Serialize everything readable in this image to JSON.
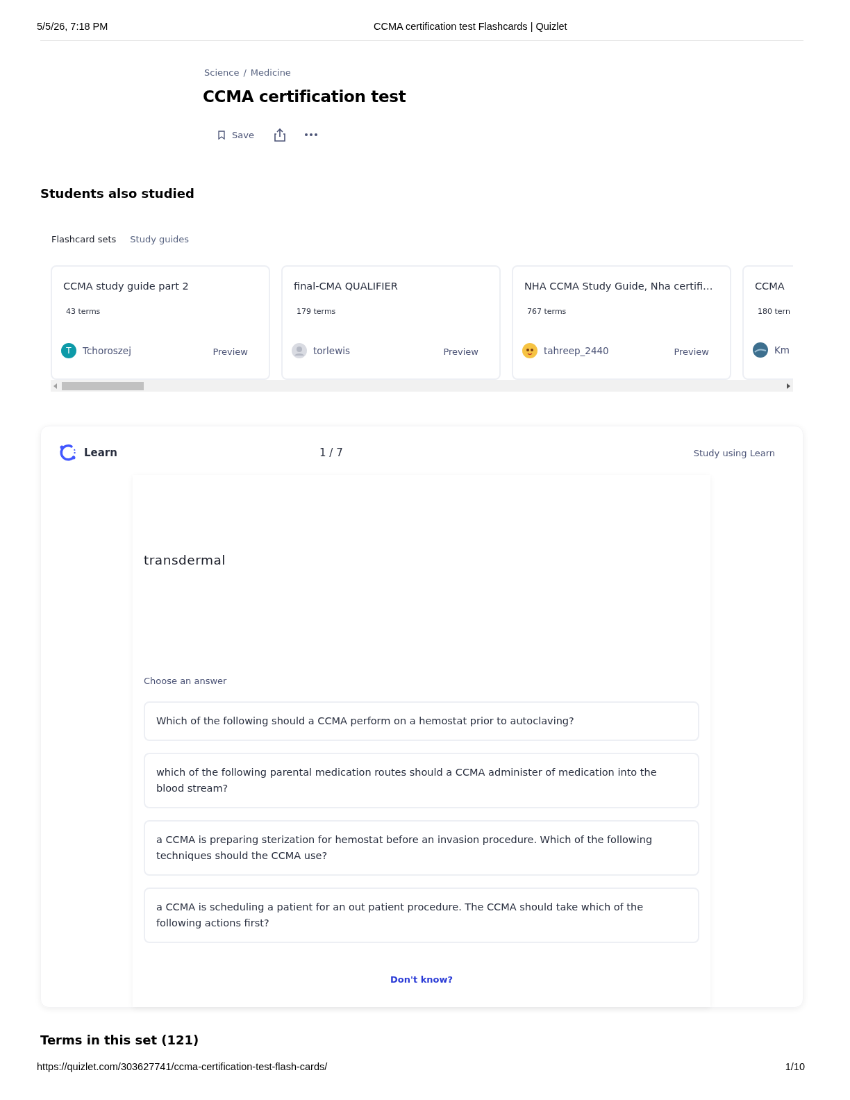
{
  "print_header": {
    "date": "5/5/26, 7:18 PM",
    "title": "CCMA certification test Flashcards | Quizlet"
  },
  "breadcrumbs": [
    "Science",
    "Medicine"
  ],
  "breadcrumb_separator": "/",
  "set_title": "CCMA certification test",
  "actions": {
    "save": "Save"
  },
  "students_also_studied": {
    "heading": "Students also studied",
    "tabs": [
      {
        "label": "Flashcard sets",
        "selected": true
      },
      {
        "label": "Study guides",
        "selected": false
      }
    ],
    "cards": [
      {
        "title": "CCMA study guide part 2",
        "terms": "43 terms",
        "author": "Tchoroszej",
        "avatar": {
          "kind": "letter",
          "letter": "T"
        },
        "preview": "Preview"
      },
      {
        "title": "final-CMA QUALIFIER",
        "terms": "179 terms",
        "author": "torlewis",
        "avatar": {
          "kind": "generic"
        },
        "preview": "Preview"
      },
      {
        "title": "NHA CCMA Study Guide, Nha certifi…",
        "terms": "767 terms",
        "author": "tahreep_2440",
        "avatar": {
          "kind": "sticker"
        },
        "preview": "Preview"
      },
      {
        "title": "CCMA",
        "terms": "180 tern",
        "author": "Km",
        "avatar": {
          "kind": "photo"
        }
      }
    ]
  },
  "learn": {
    "label": "Learn",
    "progress": "1 / 7",
    "study_link": "Study using Learn",
    "term": "transdermal",
    "prompt": "Choose an answer",
    "options": [
      "Which of the following should a CCMA perform on a hemostat prior to autoclaving?",
      "which of the following parental medication routes should a CCMA administer of medication into the blood stream?",
      "a CCMA is preparing sterization for hemostat before an invasion procedure. Which of the following techniques should the CCMA use?",
      "a CCMA is scheduling a patient for an out patient procedure. The CCMA should take which of the following actions first?"
    ],
    "dont_know": "Don't know?"
  },
  "terms_heading": "Terms in this set (121)",
  "print_footer": {
    "url": "https://quizlet.com/303627741/ccma-certification-test-flash-cards/",
    "page": "1/10"
  }
}
